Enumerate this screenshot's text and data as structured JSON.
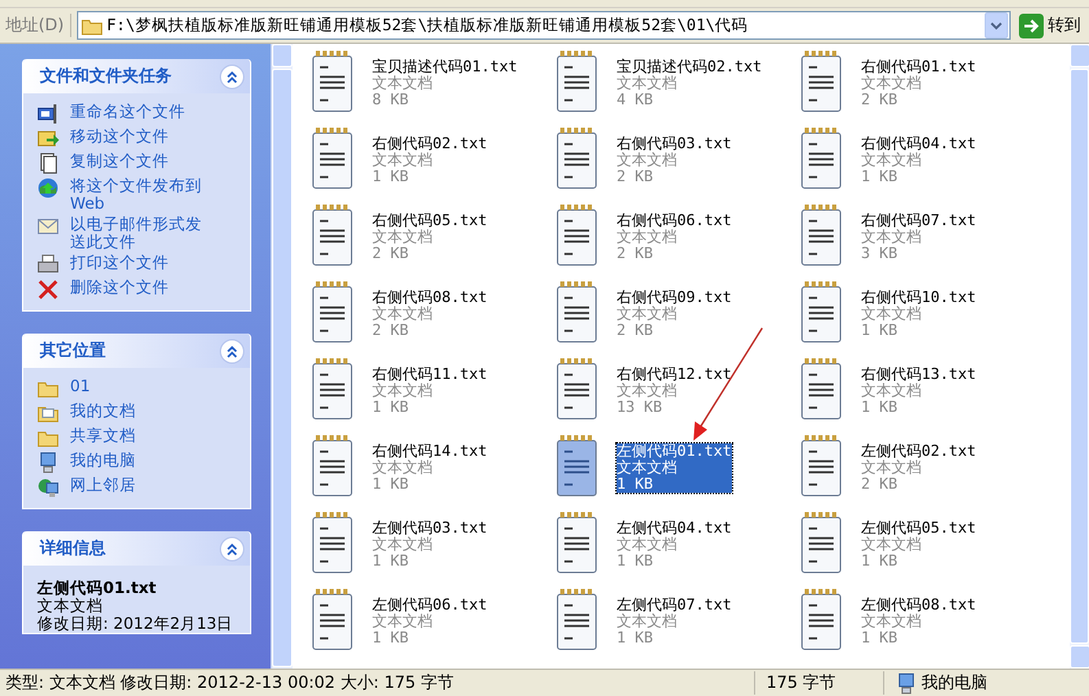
{
  "address_bar": {
    "label": "地址(D)",
    "path": "F:\\梦枫扶植版标准版新旺铺通用模板52套\\扶植版标准版新旺铺通用模板52套\\01\\代码",
    "go_button": "转到"
  },
  "task_panels": [
    {
      "title": "文件和文件夹任务",
      "expanded": true,
      "items": [
        {
          "label": "重命名这个文件",
          "kind": "rename"
        },
        {
          "label": "移动这个文件",
          "kind": "move"
        },
        {
          "label": "复制这个文件",
          "kind": "copy"
        },
        {
          "label": "将这个文件发布到 Web",
          "kind": "publish"
        },
        {
          "label": "以电子邮件形式发送此文件",
          "kind": "email"
        },
        {
          "label": "打印这个文件",
          "kind": "print"
        },
        {
          "label": "删除这个文件",
          "kind": "delete"
        }
      ]
    },
    {
      "title": "其它位置",
      "expanded": true,
      "items": [
        {
          "label": "01",
          "kind": "folder"
        },
        {
          "label": "我的文档",
          "kind": "documents"
        },
        {
          "label": "共享文档",
          "kind": "folder"
        },
        {
          "label": "我的电脑",
          "kind": "computer"
        },
        {
          "label": "网上邻居",
          "kind": "network"
        }
      ]
    }
  ],
  "details_panel": {
    "title": "详细信息",
    "expanded": true,
    "name": "左侧代码01.txt",
    "type": "文本文档",
    "modified": "修改日期: 2012年2月13日"
  },
  "files": [
    {
      "name": "宝贝描述代码01.txt",
      "type": "文本文档",
      "size": "8 KB",
      "selected": false
    },
    {
      "name": "宝贝描述代码02.txt",
      "type": "文本文档",
      "size": "4 KB",
      "selected": false
    },
    {
      "name": "右侧代码01.txt",
      "type": "文本文档",
      "size": "2 KB",
      "selected": false
    },
    {
      "name": "右侧代码02.txt",
      "type": "文本文档",
      "size": "1 KB",
      "selected": false
    },
    {
      "name": "右侧代码03.txt",
      "type": "文本文档",
      "size": "2 KB",
      "selected": false
    },
    {
      "name": "右侧代码04.txt",
      "type": "文本文档",
      "size": "1 KB",
      "selected": false
    },
    {
      "name": "右侧代码05.txt",
      "type": "文本文档",
      "size": "2 KB",
      "selected": false
    },
    {
      "name": "右侧代码06.txt",
      "type": "文本文档",
      "size": "2 KB",
      "selected": false
    },
    {
      "name": "右侧代码07.txt",
      "type": "文本文档",
      "size": "3 KB",
      "selected": false
    },
    {
      "name": "右侧代码08.txt",
      "type": "文本文档",
      "size": "2 KB",
      "selected": false
    },
    {
      "name": "右侧代码09.txt",
      "type": "文本文档",
      "size": "2 KB",
      "selected": false
    },
    {
      "name": "右侧代码10.txt",
      "type": "文本文档",
      "size": "1 KB",
      "selected": false
    },
    {
      "name": "右侧代码11.txt",
      "type": "文本文档",
      "size": "1 KB",
      "selected": false
    },
    {
      "name": "右侧代码12.txt",
      "type": "文本文档",
      "size": "13 KB",
      "selected": false
    },
    {
      "name": "右侧代码13.txt",
      "type": "文本文档",
      "size": "1 KB",
      "selected": false
    },
    {
      "name": "右侧代码14.txt",
      "type": "文本文档",
      "size": "1 KB",
      "selected": false
    },
    {
      "name": "左侧代码01.txt",
      "type": "文本文档",
      "size": "1 KB",
      "selected": true
    },
    {
      "name": "左侧代码02.txt",
      "type": "文本文档",
      "size": "2 KB",
      "selected": false
    },
    {
      "name": "左侧代码03.txt",
      "type": "文本文档",
      "size": "1 KB",
      "selected": false
    },
    {
      "name": "左侧代码04.txt",
      "type": "文本文档",
      "size": "1 KB",
      "selected": false
    },
    {
      "name": "左侧代码05.txt",
      "type": "文本文档",
      "size": "1 KB",
      "selected": false
    },
    {
      "name": "左侧代码06.txt",
      "type": "文本文档",
      "size": "1 KB",
      "selected": false
    },
    {
      "name": "左侧代码07.txt",
      "type": "文本文档",
      "size": "1 KB",
      "selected": false
    },
    {
      "name": "左侧代码08.txt",
      "type": "文本文档",
      "size": "1 KB",
      "selected": false
    }
  ],
  "status_bar": {
    "info": "类型: 文本文档 修改日期: 2012-2-13 00:02 大小: 175 字节",
    "size": "175 字节",
    "location": "我的电脑"
  }
}
